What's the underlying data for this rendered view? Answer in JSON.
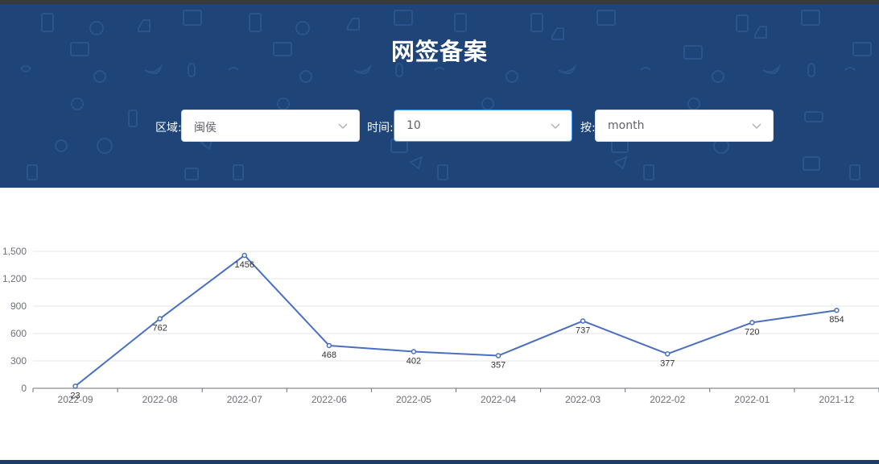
{
  "page": {
    "title": "网签备案"
  },
  "filters": {
    "region": {
      "label": "区域:",
      "value": "闽侯"
    },
    "time": {
      "label": "时间:",
      "value": "10"
    },
    "by": {
      "label": "按:",
      "value": "month"
    }
  },
  "colors": {
    "header_bg": "#1e4478",
    "line": "#4a6fc1",
    "focus_border": "#409eff"
  },
  "chart_data": {
    "type": "line",
    "categories": [
      "2022-09",
      "2022-08",
      "2022-07",
      "2022-06",
      "2022-05",
      "2022-04",
      "2022-03",
      "2022-02",
      "2022-01",
      "2021-12"
    ],
    "series": [
      {
        "values": [
          23,
          762,
          1456,
          468,
          402,
          357,
          737,
          377,
          720,
          854
        ]
      }
    ],
    "yticks": [
      "0",
      "300",
      "600",
      "900",
      "1,200",
      "1,500"
    ],
    "ylim": [
      0,
      1500
    ],
    "grid": true,
    "legend": false,
    "data_labels": true
  }
}
